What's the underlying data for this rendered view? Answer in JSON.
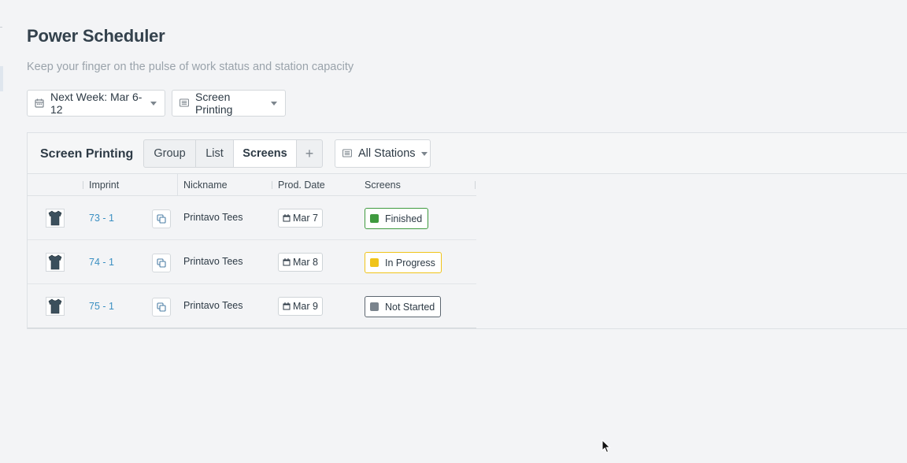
{
  "page": {
    "title": "Power Scheduler",
    "subtitle": "Keep your finger on the pulse of work status and station capacity"
  },
  "filters": {
    "week": {
      "label": "Next Week: Mar 6-12",
      "icon": "calendar-icon"
    },
    "department": {
      "label": "Screen Printing",
      "icon": "list-icon"
    }
  },
  "card": {
    "title": "Screen Printing",
    "view_options": [
      {
        "label": "Group"
      },
      {
        "label": "List"
      },
      {
        "label": "Screens",
        "active": true
      },
      {
        "label": "+"
      }
    ],
    "stations": {
      "label": "All Stations",
      "icon": "list-icon"
    }
  },
  "table": {
    "columns": [
      "Imprint",
      "Nickname",
      "Prod. Date",
      "Screens"
    ],
    "rows": [
      {
        "imprint": "73 - 1",
        "nickname": "Printavo Tees",
        "prod_date": "Mar 7",
        "status": "Finished"
      },
      {
        "imprint": "74 - 1",
        "nickname": "Printavo Tees",
        "prod_date": "Mar 8",
        "status": "In Progress"
      },
      {
        "imprint": "75 - 1",
        "nickname": "Printavo Tees",
        "prod_date": "Mar 9",
        "status": "Not Started"
      }
    ]
  },
  "colors": {
    "finished_border": "#3f9a3f",
    "finished_fill": "#3f9a3f",
    "in_progress_border": "#f0c419",
    "in_progress_fill": "#f0c419",
    "not_started_border": "#5c6670",
    "not_started_fill": "#7a848d",
    "link": "#3a8fc2"
  }
}
